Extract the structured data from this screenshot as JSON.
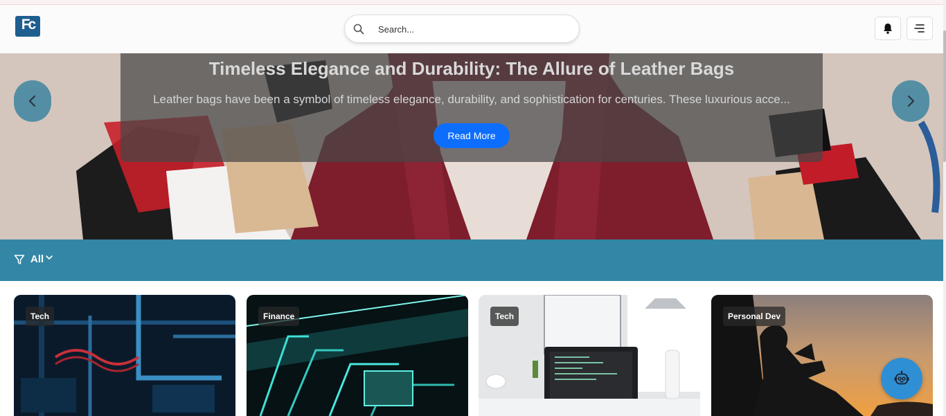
{
  "header": {
    "logo_text": "Fc",
    "search_placeholder": "Search...",
    "bell_icon": "bell-icon",
    "menu_icon": "hamburger-menu-icon"
  },
  "hero": {
    "title": "Timeless Elegance and Durability: The Allure of Leather Bags",
    "excerpt": "Leather bags have been a symbol of timeless elegance, durability, and sophistication for centuries. These luxurious acce...",
    "read_more_label": "Read More",
    "prev_icon": "chevron-left-icon",
    "next_icon": "chevron-right-icon"
  },
  "filter": {
    "icon": "filter-icon",
    "label": "All",
    "dropdown_icon": "chevron-down-icon"
  },
  "cards": [
    {
      "category": "Tech"
    },
    {
      "category": "Finance"
    },
    {
      "category": "Tech"
    },
    {
      "category": "Personal Dev"
    }
  ],
  "chatbot": {
    "icon": "robot-icon"
  },
  "colors": {
    "filter_bar": "#3386a6",
    "read_more": "#0d6efd",
    "chatbot": "#2f8fd4",
    "logo": "#1f5f8f"
  }
}
